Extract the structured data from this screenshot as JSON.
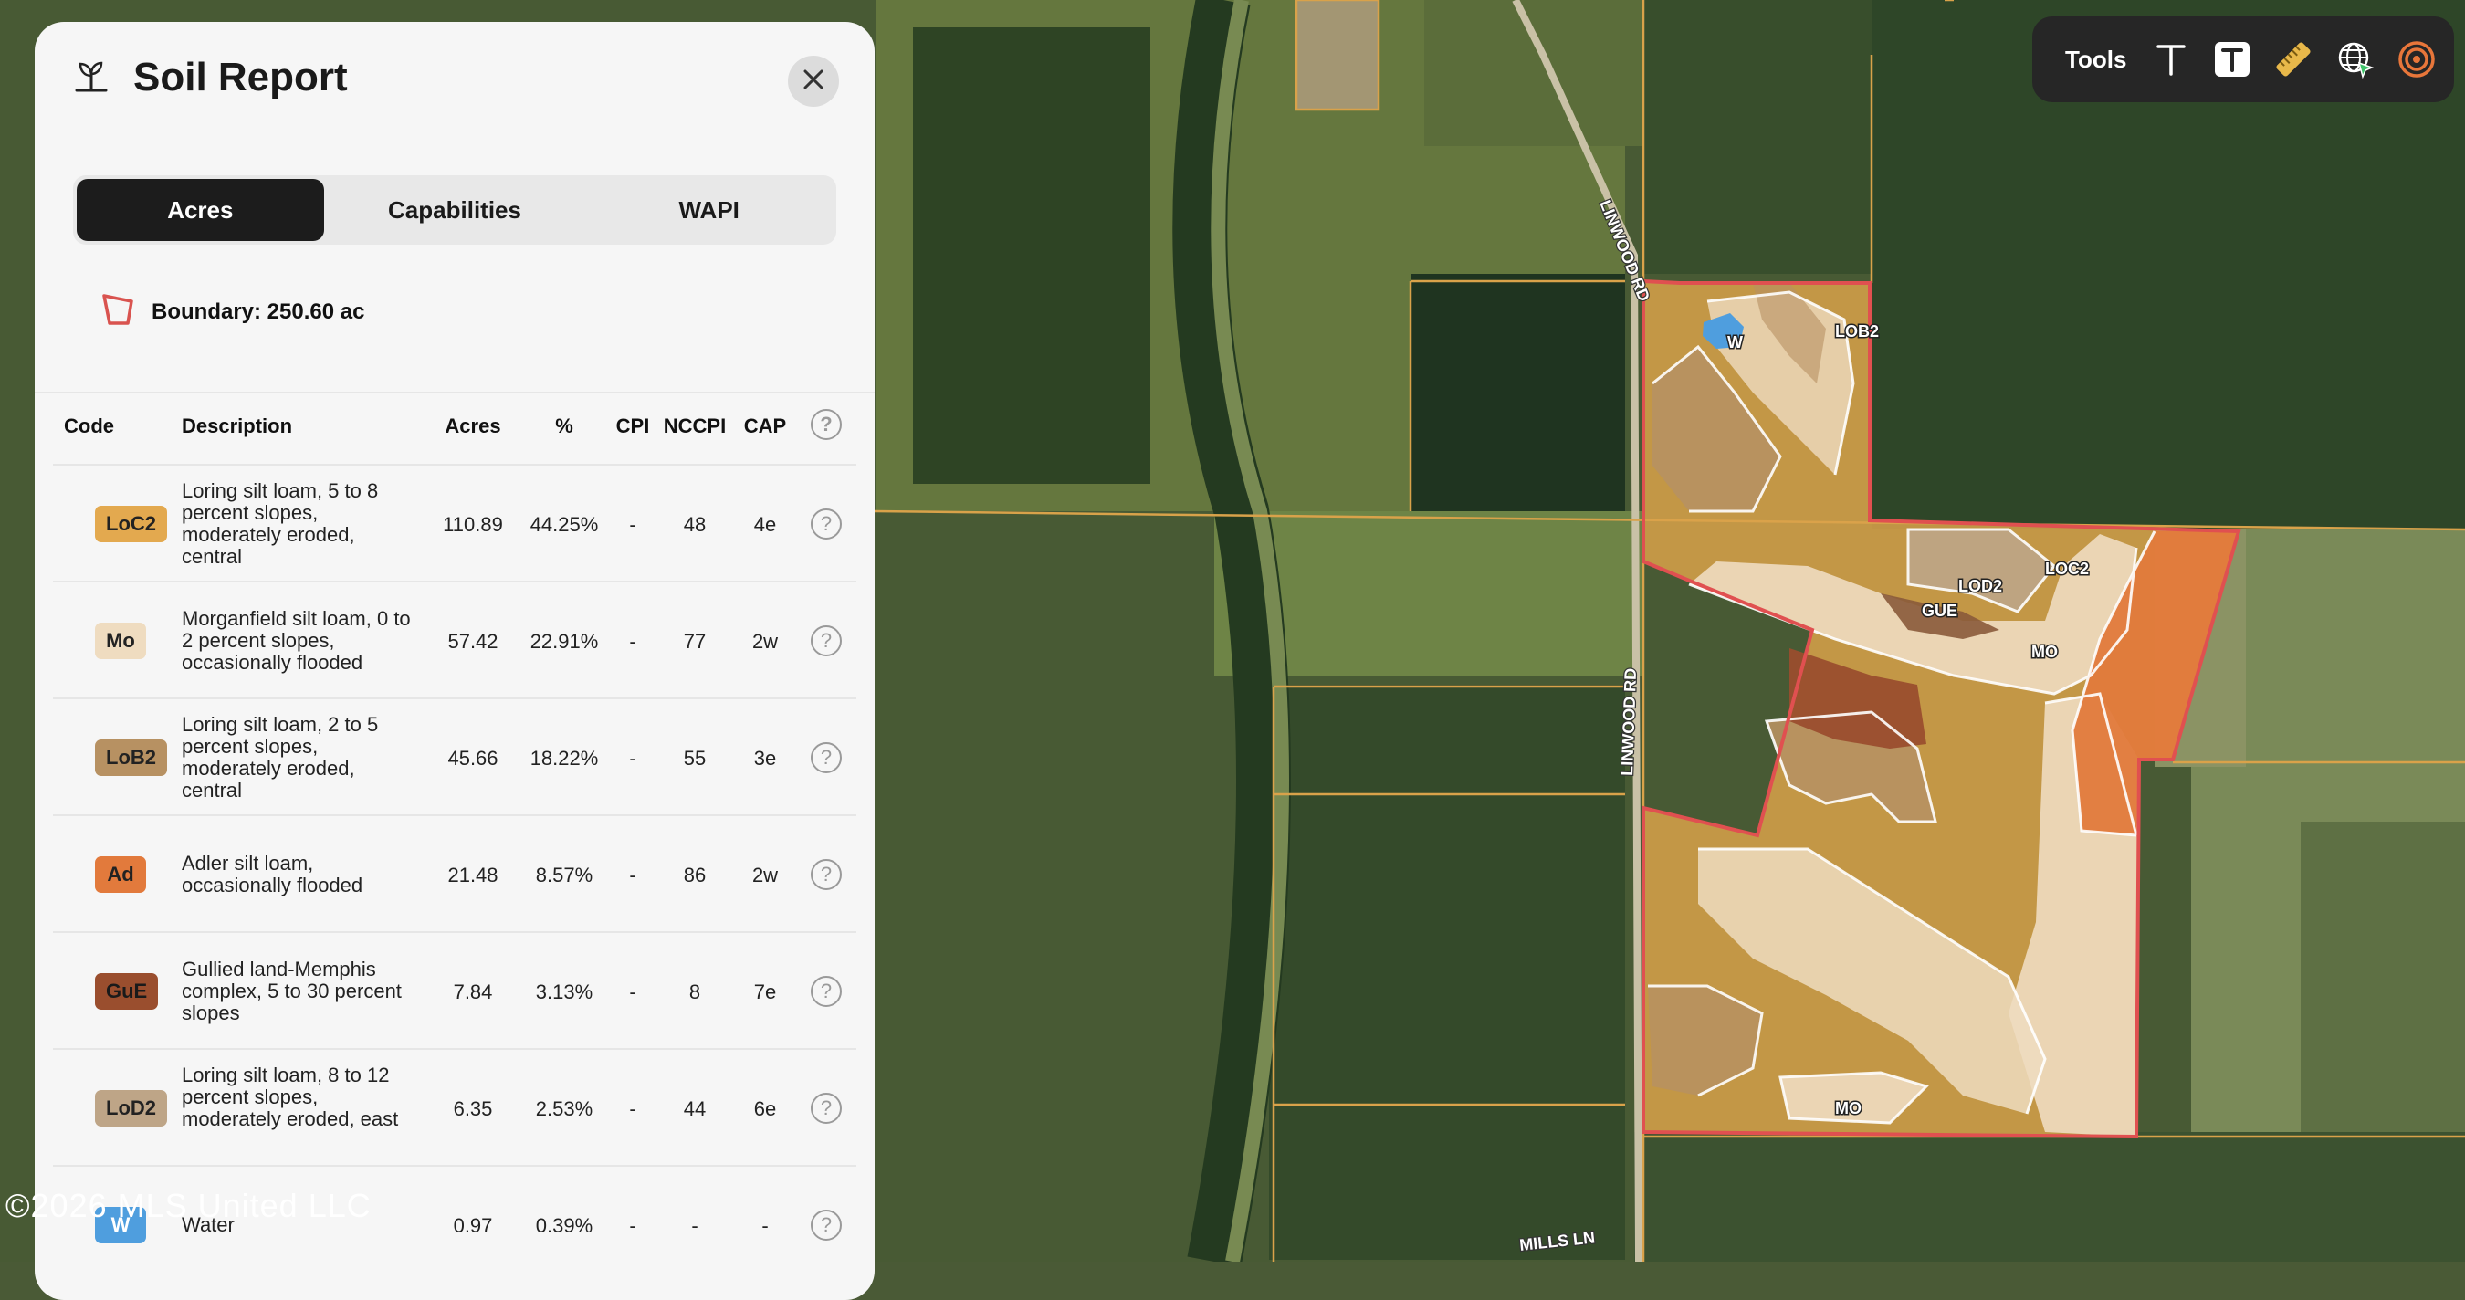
{
  "map": {
    "road_labels": [
      "LINWOOD RD",
      "LINWOOD RD",
      "MILLS LN"
    ],
    "soil_labels": [
      "W",
      "LOB2",
      "LOC2",
      "LOD2",
      "GUE",
      "MO",
      "MO"
    ],
    "boundary_color": "#e05050",
    "parcel_line_color": "#d9a24a"
  },
  "toolbar": {
    "label": "Tools",
    "tools": [
      "text-tool",
      "text-box-tool",
      "ruler-tool",
      "globe-tool",
      "radius-tool"
    ]
  },
  "panel": {
    "title": "Soil Report",
    "tabs": [
      {
        "label": "Acres",
        "active": true
      },
      {
        "label": "Capabilities",
        "active": false
      },
      {
        "label": "WAPI",
        "active": false
      }
    ],
    "boundary_text": "Boundary: 250.60 ac",
    "columns": {
      "code": "Code",
      "description": "Description",
      "acres": "Acres",
      "pct": "%",
      "cpi": "CPI",
      "nccpi": "NCCPI",
      "cap": "CAP"
    },
    "rows": [
      {
        "code": "LoC2",
        "color": "#e3a94f",
        "description": "Loring silt loam, 5 to 8 percent slopes, moderately eroded, central",
        "acres": "110.89",
        "pct": "44.25%",
        "cpi": "-",
        "nccpi": "48",
        "cap": "4e"
      },
      {
        "code": "Mo",
        "color": "#efdcc0",
        "description": "Morganfield silt loam, 0 to 2 percent slopes, occasionally flooded",
        "acres": "57.42",
        "pct": "22.91%",
        "cpi": "-",
        "nccpi": "77",
        "cap": "2w"
      },
      {
        "code": "LoB2",
        "color": "#b79162",
        "description": "Loring silt loam, 2 to 5 percent slopes, moderately eroded, central",
        "acres": "45.66",
        "pct": "18.22%",
        "cpi": "-",
        "nccpi": "55",
        "cap": "3e"
      },
      {
        "code": "Ad",
        "color": "#e27a3c",
        "description": "Adler silt loam, occasionally flooded",
        "acres": "21.48",
        "pct": "8.57%",
        "cpi": "-",
        "nccpi": "86",
        "cap": "2w"
      },
      {
        "code": "GuE",
        "color": "#9a4e2e",
        "description": "Gullied land-Memphis complex, 5 to 30 percent slopes",
        "acres": "7.84",
        "pct": "3.13%",
        "cpi": "-",
        "nccpi": "8",
        "cap": "7e"
      },
      {
        "code": "LoD2",
        "color": "#bea587",
        "description": "Loring silt loam, 8 to 12 percent slopes, moderately eroded, east",
        "acres": "6.35",
        "pct": "2.53%",
        "cpi": "-",
        "nccpi": "44",
        "cap": "6e"
      },
      {
        "code": "W",
        "color": "#4f9ede",
        "description": "Water",
        "acres": "0.97",
        "pct": "0.39%",
        "cpi": "-",
        "nccpi": "-",
        "cap": "-"
      }
    ]
  },
  "copyright": "©2026 MLS United LLC"
}
